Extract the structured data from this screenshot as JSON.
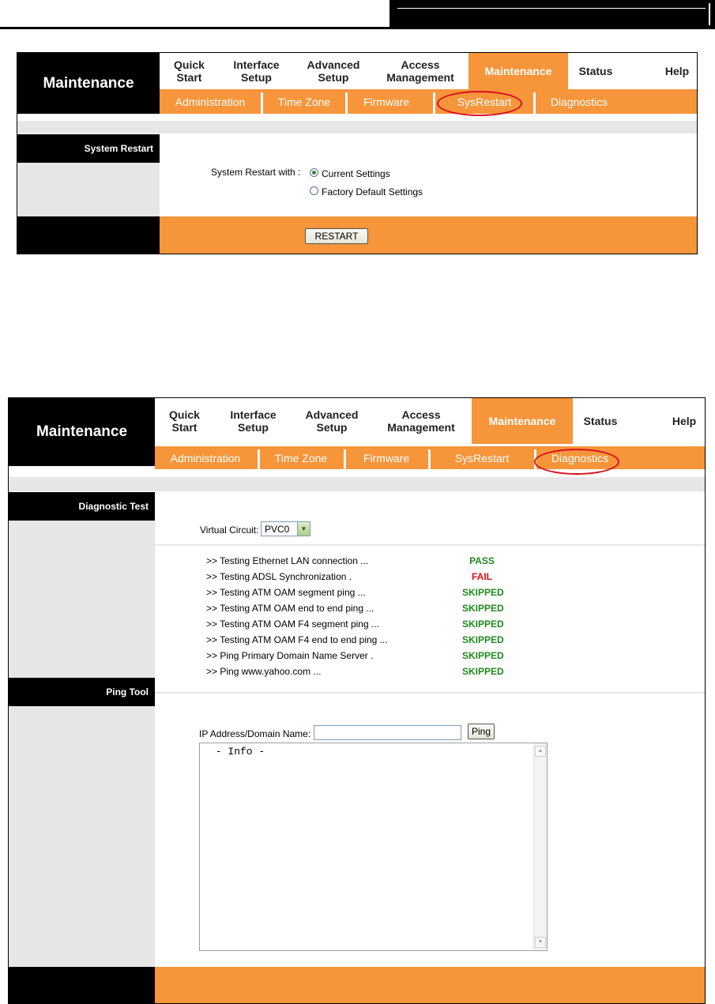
{
  "top_nav": {
    "quick_start": [
      "Quick",
      "Start"
    ],
    "interface_setup": [
      "Interface",
      "Setup"
    ],
    "advanced_setup": [
      "Advanced",
      "Setup"
    ],
    "access_management": [
      "Access",
      "Management"
    ],
    "maintenance": "Maintenance",
    "status": "Status",
    "help": "Help"
  },
  "section_title": "Maintenance",
  "sub_nav": {
    "administration": "Administration",
    "time_zone": "Time Zone",
    "firmware": "Firmware",
    "sysrestart": "SysRestart",
    "diagnostics": "Diagnostics"
  },
  "restart_panel": {
    "side_title": "System Restart",
    "label": "System Restart with :",
    "options": [
      "Current Settings",
      "Factory Default Settings"
    ],
    "selected_option": "Current Settings",
    "button": "RESTART"
  },
  "diagnostics_panel": {
    "side_title": "Diagnostic Test",
    "virtual_circuit_label": "Virtual Circuit:",
    "virtual_circuit_value": "PVC0",
    "tests": [
      {
        "label": ">> Testing Ethernet LAN connection ...",
        "result": "PASS",
        "color": "#1f8a1f"
      },
      {
        "label": ">> Testing ADSL Synchronization .",
        "result": "FAIL",
        "color": "#e0101a"
      },
      {
        "label": ">> Testing ATM OAM segment ping ...",
        "result": "SKIPPED",
        "color": "#1f8a1f"
      },
      {
        "label": ">> Testing ATM OAM end to end ping ...",
        "result": "SKIPPED",
        "color": "#1f8a1f"
      },
      {
        "label": ">> Testing ATM OAM F4 segment ping ...",
        "result": "SKIPPED",
        "color": "#1f8a1f"
      },
      {
        "label": ">> Testing ATM OAM F4 end to end ping ...",
        "result": "SKIPPED",
        "color": "#1f8a1f"
      },
      {
        "label": ">> Ping Primary Domain Name Server .",
        "result": "SKIPPED",
        "color": "#1f8a1f"
      },
      {
        "label": ">> Ping www.yahoo.com ...",
        "result": "SKIPPED",
        "color": "#1f8a1f"
      }
    ],
    "ping_side_title": "Ping Tool",
    "ip_label": "IP Address/Domain Name:",
    "ip_value": "",
    "ping_button": "Ping",
    "info_text": " - Info -"
  },
  "colors": {
    "orange": "#f7953a",
    "black": "#000000",
    "gray": "#e6e6e6",
    "highlight": "#d8101e"
  }
}
